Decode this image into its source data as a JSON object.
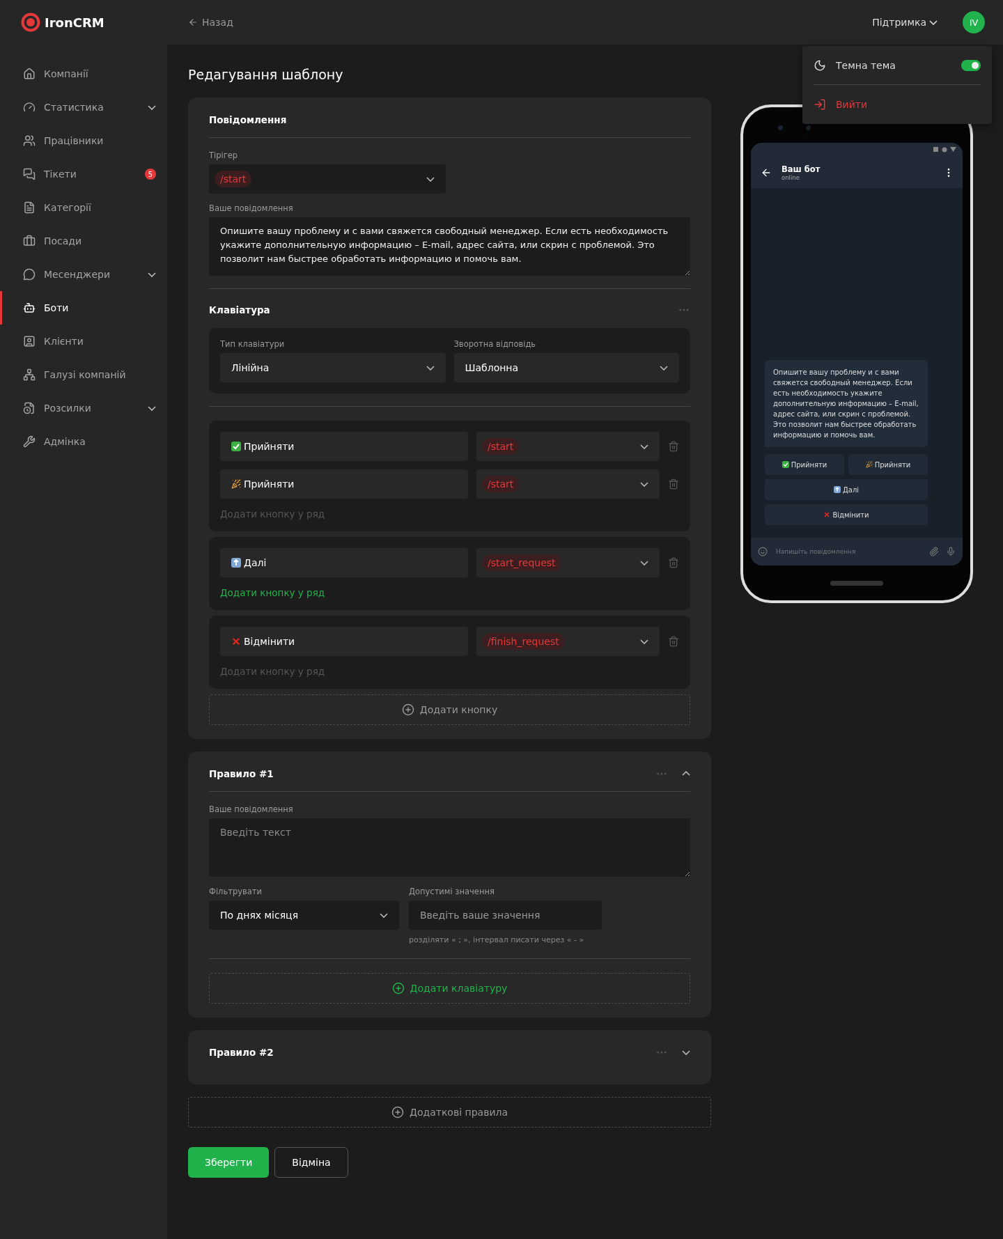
{
  "header": {
    "logo": "IronCRM",
    "back": "Назад",
    "support": "Підтримка",
    "avatar": "IV"
  },
  "user_menu": {
    "dark_theme": {
      "label": "Темна тема",
      "on": true
    },
    "logout": "Вийти"
  },
  "sidebar": {
    "items": [
      {
        "label": "Компанії",
        "selected": false
      },
      {
        "label": "Статистика",
        "selected": false,
        "expanded": false
      },
      {
        "label": "Працівники",
        "selected": false
      },
      {
        "label": "Тікети",
        "selected": false,
        "badge": "5"
      },
      {
        "label": "Категорії",
        "selected": false
      },
      {
        "label": "Посади",
        "selected": false
      },
      {
        "label": "Месенджери",
        "selected": false,
        "expanded": false
      },
      {
        "label": "Боти",
        "selected": true
      },
      {
        "label": "Клієнти",
        "selected": false
      },
      {
        "label": "Галузі компаній",
        "selected": false
      },
      {
        "label": "Розсилки",
        "selected": false,
        "expanded": false
      },
      {
        "label": "Адмінка",
        "selected": false
      }
    ]
  },
  "page": {
    "title": "Редагування шаблону"
  },
  "message_card": {
    "title": "Повідомлення",
    "trigger": {
      "label": "Тірігер",
      "value": "/start"
    },
    "message": {
      "label": "Ваше повідомлення",
      "value": "Опишите вашу проблему и с вами свяжется свободный менеджер. Если есть необходимость укажите дополнительную информацию – E-mail, адрес сайта, или скрин с проблемой. Это позволит нам быстрее обработать информацию и помочь вам."
    },
    "keyboard": {
      "title": "Клавіатура",
      "type": {
        "label": "Тип клавіатури",
        "value": "Лінійна"
      },
      "reply": {
        "label": "Зворотна відповідь",
        "value": "Шаблонна"
      }
    },
    "rows": [
      {
        "buttons": [
          {
            "kind": "check",
            "text": "Прийняти",
            "command": "/start"
          },
          {
            "kind": "party",
            "text": "Прийняти",
            "command": "/start"
          }
        ],
        "add_label": "Додати кнопку у ряд",
        "active": false
      },
      {
        "buttons": [
          {
            "kind": "up",
            "text": "Далі",
            "command": "/start_request"
          }
        ],
        "add_label": "Додати кнопку у ряд",
        "active": true
      },
      {
        "buttons": [
          {
            "kind": "cross",
            "text": "Відмінити",
            "command": "/finish_request"
          }
        ],
        "add_label": "Додати кнопку у ряд",
        "active": false
      }
    ],
    "add_button": "Додати кнопку"
  },
  "rules": [
    {
      "title": "Правило #1",
      "expanded": true,
      "message": {
        "label": "Ваше повідомлення",
        "placeholder": "Введіть текст"
      },
      "filter": {
        "label": "Фільтрувати",
        "value": "По днях місяця"
      },
      "allowed": {
        "label": "Допустимі значення",
        "placeholder": "Введіть ваше значення",
        "hint": "розділяти « ; », інтервал писати через « - »"
      },
      "add_keyboard": "Додати клавіатуру"
    },
    {
      "title": "Правило #2",
      "expanded": false
    }
  ],
  "add_rules": "Додаткові правила",
  "actions": {
    "save": "Зберегти",
    "cancel": "Відміна"
  },
  "preview": {
    "bot_name": "Ваш бот",
    "status": "online",
    "message": "Опишите вашу проблему и с вами свяжется свободный менеджер. Если есть необходимость укажите дополнительную информацию – E-mail, адрес сайта, или скрин с проблемой. Это позволит нам быстрее обработать информацию и помочь вам.",
    "rows": [
      [
        {
          "kind": "check",
          "text": "Прийняти"
        },
        {
          "kind": "party",
          "text": "Прийняти"
        }
      ],
      [
        {
          "kind": "up",
          "text": "Далі"
        }
      ],
      [
        {
          "kind": "cross",
          "text": "Відмінити"
        }
      ]
    ],
    "input_placeholder": "Напишіть повідомлення"
  }
}
